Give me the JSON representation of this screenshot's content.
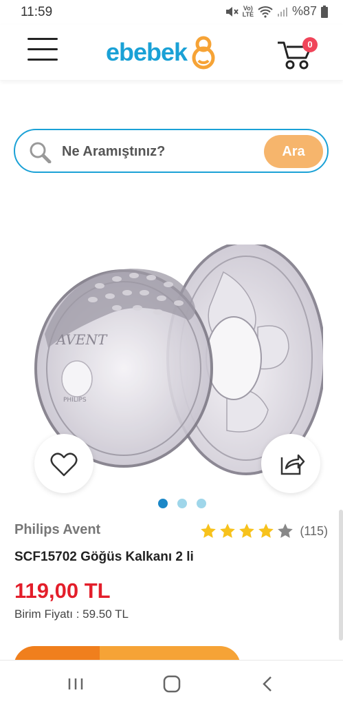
{
  "status_bar": {
    "time": "11:59",
    "network": "LTE",
    "battery": "%87"
  },
  "header": {
    "logo_text": "ebebek",
    "cart_count": "0"
  },
  "search": {
    "placeholder": "Ne Aramıştınız?",
    "button_label": "Ara"
  },
  "carousel": {
    "slide_count": 3,
    "active_index": 0
  },
  "product": {
    "brand": "Philips Avent",
    "rating": 4,
    "rating_max": 5,
    "review_count": "(115)",
    "name": "SCF15702 Göğüs Kalkanı 2 li",
    "price": "119,00 TL",
    "unit_price": "Birim Fiyatı : 59.50 TL",
    "image_text": {
      "brand_mark": "AVENT",
      "maker_mark": "PHILIPS"
    }
  },
  "colors": {
    "brand_blue": "#1aa1d6",
    "orange": "#f6b56c",
    "price_red": "#e31e2a",
    "badge": "#f0455a"
  },
  "icons": [
    "menu-icon",
    "cart-icon",
    "search-icon",
    "heart-icon",
    "share-icon",
    "recents-icon",
    "home-icon",
    "back-icon"
  ]
}
